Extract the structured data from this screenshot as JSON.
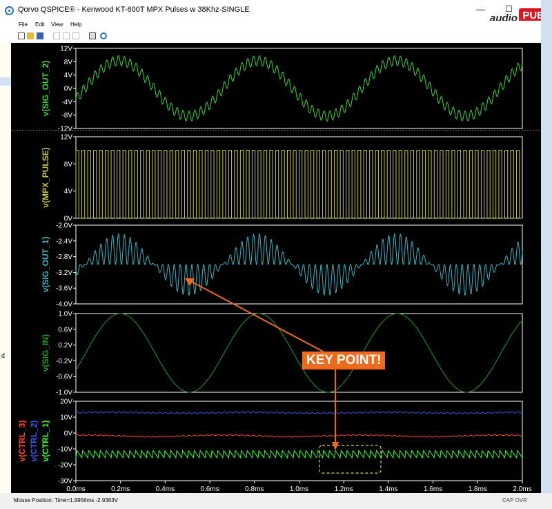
{
  "window": {
    "title": "Qorvo QSPICE® - Kenwood KT-600T MPX Pulses w 38Khz-SINGLE",
    "controls": {
      "minimize": "—",
      "maximize": "☐"
    }
  },
  "brand": {
    "text_audio": "audio",
    "text_pub": "PUB",
    "color": "#d71920"
  },
  "menu": [
    "File",
    "Edit",
    "View",
    "Help"
  ],
  "toolbar": {
    "icons": [
      "new-file-icon",
      "open-folder-icon",
      "save-icon",
      "cut-icon",
      "copy-icon",
      "paste-icon",
      "print-icon",
      "print-preview-icon",
      "help-icon"
    ]
  },
  "behind_window": {
    "partial_text": "d"
  },
  "status": {
    "mouse_position": "Mouse Position: Time=1.9956ms -2.9383V",
    "keys": "CAP OVR"
  },
  "annotation": {
    "label": "KEY POINT!",
    "color": "#ee6b1e",
    "box_color": "#e3d26a"
  },
  "colors": {
    "sig_out_2": "#3cd83c",
    "mpx_pulse": "#c8c84a",
    "sig_out_1": "#3ab8c8",
    "sig_in": "#2a9a2a",
    "ctrl_1": "#38ff38",
    "ctrl_2": "#3a5ae8",
    "ctrl_3": "#ff4a2a",
    "axis_text": "#ffffff",
    "plot_bg": "#000000"
  },
  "chart_data": [
    {
      "type": "line",
      "series": [
        {
          "name": "v(SIG_OUT_2)",
          "description": "~1.6kHz sine amplitude ~8V with 38kHz ripple ~2V"
        }
      ],
      "yticks": [
        "12V",
        "8V",
        "4V",
        "0V",
        "-4V",
        "-8V",
        "-12V"
      ],
      "ylim": [
        -12,
        12
      ],
      "xlim": [
        0,
        2.0
      ]
    },
    {
      "type": "line",
      "series": [
        {
          "name": "v(MPX_PULSE)",
          "description": "38kHz square wave 0V to 10V"
        }
      ],
      "yticks": [
        "12V",
        "8V",
        "4V",
        "0V"
      ],
      "ylim": [
        0,
        12
      ],
      "xlim": [
        0,
        2.0
      ]
    },
    {
      "type": "line",
      "series": [
        {
          "name": "v(SIG_OUT_1)",
          "description": "switched signal around -3.0V, positive half-cycles up to -2.2V, negative down to -3.8V"
        }
      ],
      "yticks": [
        "-2.0V",
        "-2.4V",
        "-2.8V",
        "-3.2V",
        "-3.6V",
        "-4.0V"
      ],
      "ylim": [
        -4.0,
        -2.0
      ],
      "xlim": [
        0,
        2.0
      ]
    },
    {
      "type": "line",
      "series": [
        {
          "name": "v(SIG_IN)",
          "description": "sine amplitude 1V, period ~0.62ms, phase starting ~0"
        }
      ],
      "yticks": [
        "1.0V",
        "0.6V",
        "0.2V",
        "-0.2V",
        "-0.6V",
        "-1.0V"
      ],
      "ylim": [
        -1.0,
        1.0
      ],
      "xlim": [
        0,
        2.0
      ]
    },
    {
      "type": "line",
      "series": [
        {
          "name": "v(CTRL_1)",
          "description": "sawtooth-like pulses between -16V and -11V at 38kHz"
        },
        {
          "name": "v(CTRL_2)",
          "description": "flat ~13V with small ripple"
        },
        {
          "name": "v(CTRL_3)",
          "description": "~-1.5V with small wavy ripple"
        }
      ],
      "yticks": [
        "20V",
        "10V",
        "0V",
        "-10V",
        "-20V",
        "-30V"
      ],
      "ylim": [
        -30,
        20
      ],
      "xticks": [
        "0.0ms",
        "0.2ms",
        "0.4ms",
        "0.6ms",
        "0.8ms",
        "1.0ms",
        "1.2ms",
        "1.4ms",
        "1.6ms",
        "1.8ms",
        "2.0ms"
      ],
      "xlim": [
        0,
        2.0
      ]
    }
  ]
}
